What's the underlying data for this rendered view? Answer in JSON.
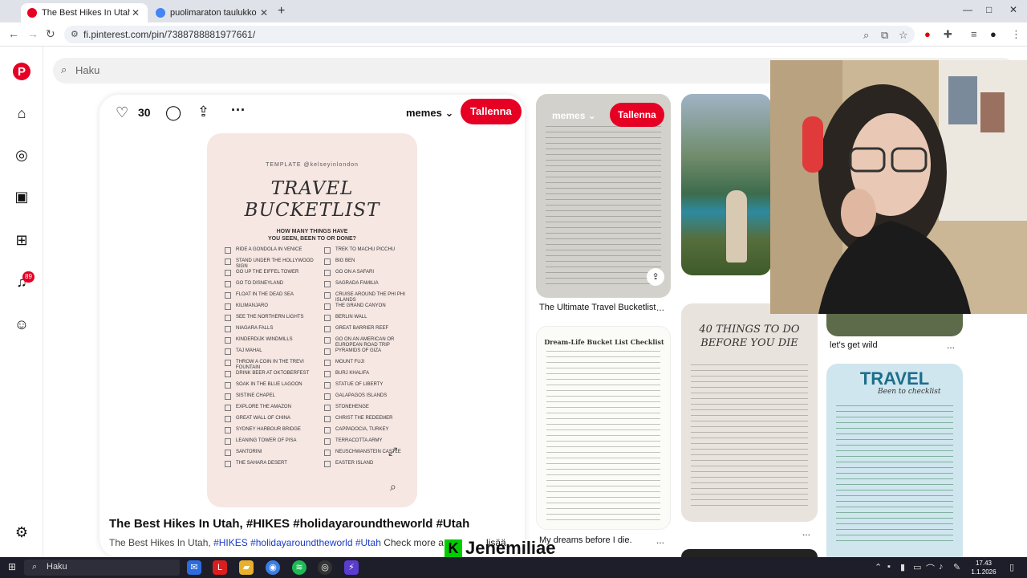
{
  "browser": {
    "tabs": [
      {
        "title": "The Best Hikes In Utah, #HIKES",
        "active": true
      },
      {
        "title": "puolimaraton taulukko - Googl",
        "active": false
      }
    ],
    "new_tab": "+",
    "url": "fi.pinterest.com/pin/7388788881977661/",
    "window_controls": [
      "—",
      "□",
      "✕"
    ]
  },
  "sidebar": {
    "notification_count": "89",
    "icons": [
      "pinterest-logo",
      "home-icon",
      "explore-icon",
      "boards-icon",
      "create-icon",
      "notifications-icon",
      "messages-icon",
      "settings-icon"
    ]
  },
  "search": {
    "placeholder": "Haku"
  },
  "pin": {
    "like_count": "30",
    "board": "memes",
    "save_label": "Tallenna",
    "image": {
      "template_tag": "TEMPLATE @kelseyinlondon",
      "title_line1": "TRAVEL",
      "title_line2": "BUCKETLIST",
      "subtitle_line1": "HOW MANY THINGS HAVE",
      "subtitle_line2": "YOU SEEN, BEEN TO OR DONE?",
      "left_items": [
        "Ride a gondola in Venice",
        "Stand under the Hollywood sign",
        "Go up the Eiffel Tower",
        "Go to Disneyland",
        "Float in the Dead Sea",
        "Kilimanjaro",
        "See the Northern Lights",
        "Niagara Falls",
        "Kinderdijk Windmills",
        "Taj Mahal",
        "Throw a coin in the Trevi Fountain",
        "Drink beer at Oktoberfest",
        "Soak in the Blue Lagoon",
        "Sistine Chapel",
        "Explore the Amazon",
        "Great Wall of China",
        "Sydney Harbour Bridge",
        "Leaning Tower of Pisa",
        "Santorini",
        "The Sahara Desert"
      ],
      "right_items": [
        "Trek to Machu Picchu",
        "Big Ben",
        "Go on a safari",
        "Sagrada Familia",
        "Cruise around the Phi Phi Islands",
        "The Grand Canyon",
        "Berlin Wall",
        "Great Barrier Reef",
        "Go on an American or European road trip",
        "Pyramids of Giza",
        "Mount Fuji",
        "Burj Khalifa",
        "Statue of Liberty",
        "Galapagos Islands",
        "Stonehenge",
        "Christ the Redeemer",
        "Cappadocia, Turkey",
        "Terracotta Army",
        "Neuschwanstein Castle",
        "Easter Island"
      ]
    },
    "title": "The Best Hikes In Utah, #HIKES #holidayaroundtheworld #Utah",
    "desc_prefix": "The Best Hikes In Utah, ",
    "desc_tags": "#HIKES #holidayaroundtheworld #Utah",
    "desc_more": " Check more a",
    "desc_more2": "lisää"
  },
  "grid": {
    "pin1": {
      "title": "The Ultimate Travel Bucketlist",
      "overlay_board": "memes",
      "overlay_save": "Tallenna"
    },
    "pin2": {
      "title": "My dreams before I die.",
      "image_title": "Dream-Life Bucket List Checklist"
    },
    "pin3": {
      "image_title_line1": "40 THINGS TO DO",
      "image_title_line2": "BEFORE YOU DIE"
    },
    "pin4": {
      "title": "let's get wild"
    },
    "pin5": {
      "image_title": "TRAVEL",
      "image_subtitle": "Been to checklist"
    },
    "more": "..."
  },
  "stream_overlay": {
    "name": "Jenemiliae"
  },
  "taskbar": {
    "search": "Haku",
    "time": "17.43",
    "date": "1.1.2026"
  },
  "colors": {
    "brand": "#e60023",
    "link": "#1a3cc7",
    "taskbar": "#1e1e2a"
  }
}
